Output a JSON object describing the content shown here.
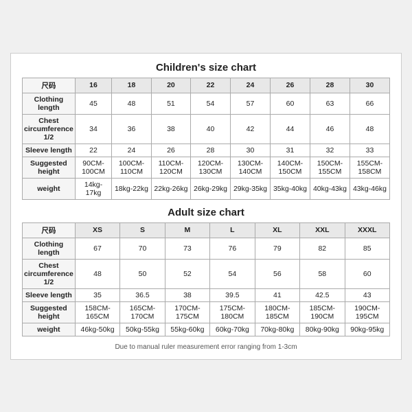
{
  "children_chart": {
    "title": "Children's size chart",
    "columns": [
      "尺码",
      "16",
      "18",
      "20",
      "22",
      "24",
      "26",
      "28",
      "30"
    ],
    "rows": [
      {
        "label": "Clothing length",
        "values": [
          "45",
          "48",
          "51",
          "54",
          "57",
          "60",
          "63",
          "66"
        ]
      },
      {
        "label": "Chest circumference 1/2",
        "values": [
          "34",
          "36",
          "38",
          "40",
          "42",
          "44",
          "46",
          "48"
        ]
      },
      {
        "label": "Sleeve length",
        "values": [
          "22",
          "24",
          "26",
          "28",
          "30",
          "31",
          "32",
          "33"
        ]
      },
      {
        "label": "Suggested height",
        "values": [
          "90CM-100CM",
          "100CM-110CM",
          "110CM-120CM",
          "120CM-130CM",
          "130CM-140CM",
          "140CM-150CM",
          "150CM-155CM",
          "155CM-158CM"
        ]
      },
      {
        "label": "weight",
        "values": [
          "14kg-17kg",
          "18kg-22kg",
          "22kg-26kg",
          "26kg-29kg",
          "29kg-35kg",
          "35kg-40kg",
          "40kg-43kg",
          "43kg-46kg"
        ]
      }
    ]
  },
  "adult_chart": {
    "title": "Adult size chart",
    "columns": [
      "尺码",
      "XS",
      "S",
      "M",
      "L",
      "XL",
      "XXL",
      "XXXL"
    ],
    "rows": [
      {
        "label": "Clothing length",
        "values": [
          "67",
          "70",
          "73",
          "76",
          "79",
          "82",
          "85"
        ]
      },
      {
        "label": "Chest circumference 1/2",
        "values": [
          "48",
          "50",
          "52",
          "54",
          "56",
          "58",
          "60"
        ]
      },
      {
        "label": "Sleeve length",
        "values": [
          "35",
          "36.5",
          "38",
          "39.5",
          "41",
          "42.5",
          "43"
        ]
      },
      {
        "label": "Suggested height",
        "values": [
          "158CM-165CM",
          "165CM-170CM",
          "170CM-175CM",
          "175CM-180CM",
          "180CM-185CM",
          "185CM-190CM",
          "190CM-195CM"
        ]
      },
      {
        "label": "weight",
        "values": [
          "46kg-50kg",
          "50kg-55kg",
          "55kg-60kg",
          "60kg-70kg",
          "70kg-80kg",
          "80kg-90kg",
          "90kg-95kg"
        ]
      }
    ]
  },
  "footer": "Due to manual ruler measurement error ranging from 1-3cm"
}
